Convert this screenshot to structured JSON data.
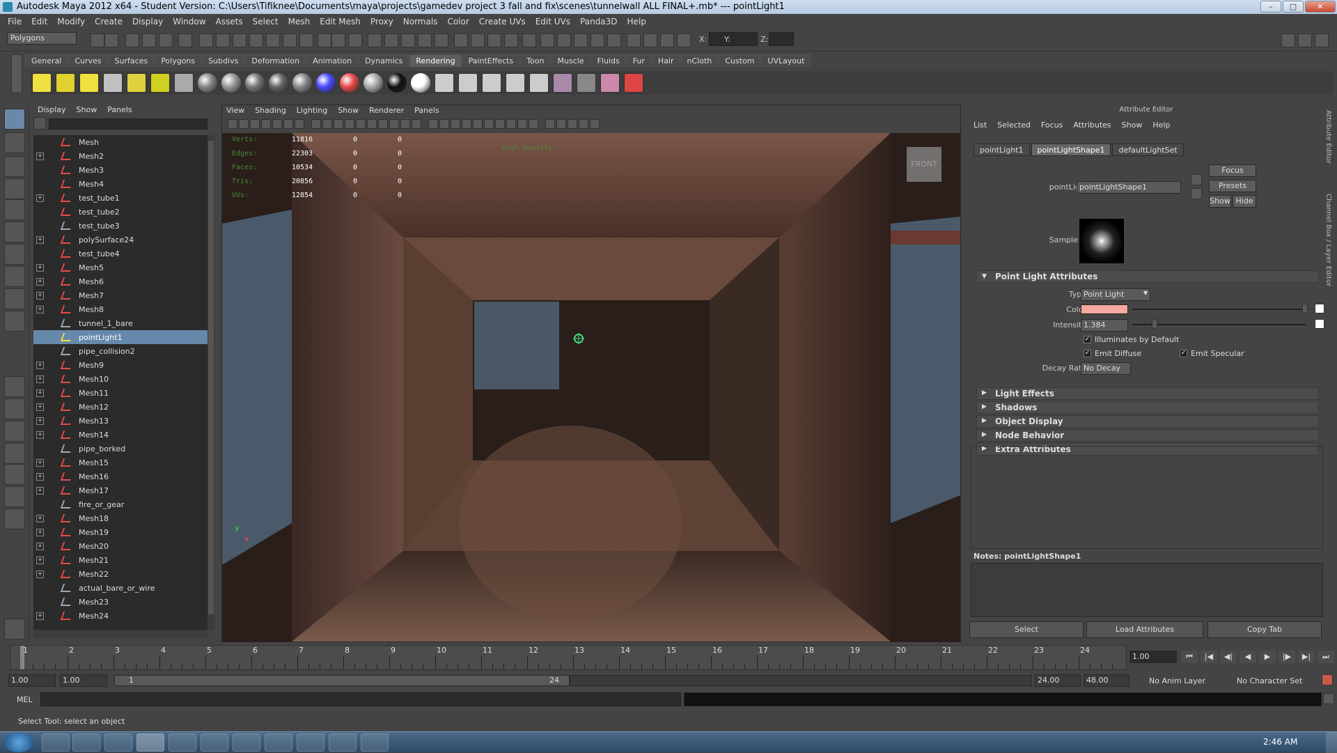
{
  "window": {
    "title": "Autodesk Maya 2012 x64 - Student Version: C:\\Users\\Tifiknee\\Documents\\maya\\projects\\gamedev project 3 fall and fix\\scenes\\tunnelwall ALL FINAL+.mb*  ---  pointLight1",
    "controls": [
      "–",
      "□",
      "✕"
    ]
  },
  "menubar": [
    "File",
    "Edit",
    "Modify",
    "Create",
    "Display",
    "Window",
    "Assets",
    "Select",
    "Mesh",
    "Edit Mesh",
    "Proxy",
    "Normals",
    "Color",
    "Create UVs",
    "Edit UVs",
    "Panda3D",
    "Help"
  ],
  "statusline": {
    "mode": "Polygons",
    "x_label": "X:",
    "y_label": "Y:",
    "z_label": "Z:"
  },
  "shelf": {
    "tabs": [
      "General",
      "Curves",
      "Surfaces",
      "Polygons",
      "Subdivs",
      "Deformation",
      "Animation",
      "Dynamics",
      "Rendering",
      "PaintEffects",
      "Toon",
      "Muscle",
      "Fluids",
      "Fur",
      "Hair",
      "nCloth",
      "Custom",
      "UVLayout"
    ],
    "active_tab": "Rendering"
  },
  "outliner": {
    "menu": [
      "Display",
      "Show",
      "Panels"
    ],
    "items": [
      {
        "label": "Mesh",
        "expand": false,
        "type": "mesh"
      },
      {
        "label": "Mesh2",
        "expand": true,
        "type": "mesh"
      },
      {
        "label": "Mesh3",
        "expand": false,
        "type": "mesh"
      },
      {
        "label": "Mesh4",
        "expand": false,
        "type": "mesh"
      },
      {
        "label": "test_tube1",
        "expand": true,
        "type": "mesh"
      },
      {
        "label": "test_tube2",
        "expand": false,
        "type": "mesh"
      },
      {
        "label": "test_tube3",
        "expand": false,
        "type": "group"
      },
      {
        "label": "polySurface24",
        "expand": true,
        "type": "mesh"
      },
      {
        "label": "test_tube4",
        "expand": false,
        "type": "mesh"
      },
      {
        "label": "Mesh5",
        "expand": true,
        "type": "mesh"
      },
      {
        "label": "Mesh6",
        "expand": true,
        "type": "mesh"
      },
      {
        "label": "Mesh7",
        "expand": true,
        "type": "mesh"
      },
      {
        "label": "Mesh8",
        "expand": true,
        "type": "mesh"
      },
      {
        "label": "tunnel_1_bare",
        "expand": false,
        "type": "group"
      },
      {
        "label": "pointLight1",
        "expand": false,
        "type": "light",
        "selected": true
      },
      {
        "label": "pipe_collision2",
        "expand": false,
        "type": "group"
      },
      {
        "label": "Mesh9",
        "expand": true,
        "type": "mesh"
      },
      {
        "label": "Mesh10",
        "expand": true,
        "type": "mesh"
      },
      {
        "label": "Mesh11",
        "expand": true,
        "type": "mesh"
      },
      {
        "label": "Mesh12",
        "expand": true,
        "type": "mesh"
      },
      {
        "label": "Mesh13",
        "expand": true,
        "type": "mesh"
      },
      {
        "label": "Mesh14",
        "expand": true,
        "type": "mesh"
      },
      {
        "label": "pipe_borked",
        "expand": false,
        "type": "group"
      },
      {
        "label": "Mesh15",
        "expand": true,
        "type": "mesh"
      },
      {
        "label": "Mesh16",
        "expand": true,
        "type": "mesh"
      },
      {
        "label": "Mesh17",
        "expand": true,
        "type": "mesh"
      },
      {
        "label": "fire_or_gear",
        "expand": false,
        "type": "group"
      },
      {
        "label": "Mesh18",
        "expand": true,
        "type": "mesh"
      },
      {
        "label": "Mesh19",
        "expand": true,
        "type": "mesh"
      },
      {
        "label": "Mesh20",
        "expand": true,
        "type": "mesh"
      },
      {
        "label": "Mesh21",
        "expand": true,
        "type": "mesh"
      },
      {
        "label": "Mesh22",
        "expand": true,
        "type": "mesh"
      },
      {
        "label": "actual_bare_or_wire",
        "expand": false,
        "type": "group"
      },
      {
        "label": "Mesh23",
        "expand": false,
        "type": "group"
      },
      {
        "label": "Mesh24",
        "expand": true,
        "type": "mesh"
      }
    ]
  },
  "viewport": {
    "menu": [
      "View",
      "Shading",
      "Lighting",
      "Show",
      "Renderer",
      "Panels"
    ],
    "hud": {
      "rows": [
        {
          "label": "Verts:",
          "a": "11816",
          "b": "0",
          "c": "0"
        },
        {
          "label": "Edges:",
          "a": "22303",
          "b": "0",
          "c": "0"
        },
        {
          "label": "Faces:",
          "a": "10534",
          "b": "0",
          "c": "0"
        },
        {
          "label": "Tris:",
          "a": "20856",
          "b": "0",
          "c": "0"
        },
        {
          "label": "UVs:",
          "a": "12854",
          "b": "0",
          "c": "0"
        }
      ],
      "quality": "High Quality",
      "cube": "FRONT",
      "axis_y": "y",
      "axis_x": "x"
    }
  },
  "attribute_editor": {
    "title": "Attribute Editor",
    "menu": [
      "List",
      "Selected",
      "Focus",
      "Attributes",
      "Show",
      "Help"
    ],
    "tabs": [
      "pointLight1",
      "pointLightShape1",
      "defaultLightSet"
    ],
    "active_tab": "pointLightShape1",
    "node_label": "pointLight:",
    "node_value": "pointLightShape1",
    "buttons": {
      "focus": "Focus",
      "presets": "Presets",
      "show": "Show",
      "hide": "Hide"
    },
    "sample_label": "Sample",
    "section_main": "Point Light Attributes",
    "type_label": "Type",
    "type_value": "Point Light",
    "color_label": "Color",
    "color_value": "#f4a8a0",
    "intensity_label": "Intensity",
    "intensity_value": "1.384",
    "illum_label": "Illuminates by Default",
    "diffuse_label": "Emit Diffuse",
    "specular_label": "Emit Specular",
    "decay_label": "Decay Rate",
    "decay_value": "No Decay",
    "sections": [
      "Light Effects",
      "Shadows",
      "Object Display",
      "Node Behavior",
      "Extra Attributes"
    ],
    "notes_label": "Notes:  pointLightShape1",
    "bottom": {
      "select": "Select",
      "load": "Load Attributes",
      "copy": "Copy Tab"
    },
    "side_tab_1": "Attribute Editor",
    "side_tab_2": "Channel Box / Layer Editor"
  },
  "timeline": {
    "ticks": [
      "1",
      "2",
      "3",
      "4",
      "5",
      "6",
      "7",
      "8",
      "9",
      "10",
      "11",
      "12",
      "13",
      "14",
      "15",
      "16",
      "17",
      "18",
      "19",
      "20",
      "21",
      "22",
      "23",
      "24"
    ],
    "current": "1.00"
  },
  "range": {
    "start": "1.00",
    "start2": "1.00",
    "slider_start": "1",
    "slider_end": "24",
    "end": "24.00",
    "end2": "48.00",
    "anim_layer": "No Anim Layer",
    "char_set": "No Character Set"
  },
  "cmdline": {
    "label": "MEL"
  },
  "helpline": {
    "text": "Select Tool: select an object"
  },
  "taskbar": {
    "clock": "2:46 AM"
  }
}
